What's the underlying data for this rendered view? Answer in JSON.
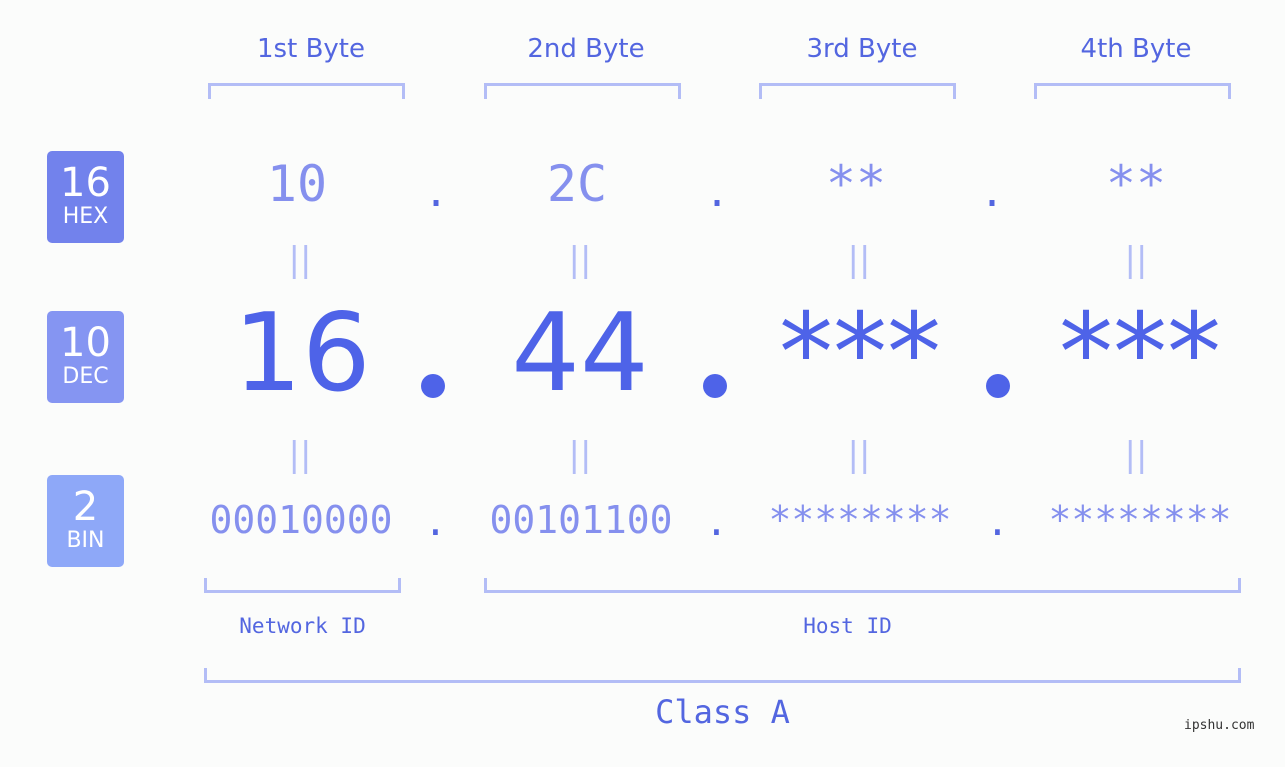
{
  "bytes": [
    {
      "title": "1st Byte",
      "hex": "10",
      "dec": "16",
      "bin": "00010000"
    },
    {
      "title": "2nd Byte",
      "hex": "2C",
      "dec": "44",
      "bin": "00101100"
    },
    {
      "title": "3rd Byte",
      "hex": "**",
      "dec": "***",
      "bin": "********"
    },
    {
      "title": "4th Byte",
      "hex": "**",
      "dec": "***",
      "bin": "********"
    }
  ],
  "badges": {
    "hex": {
      "num": "16",
      "label": "HEX",
      "color": "#7282ec"
    },
    "dec": {
      "num": "10",
      "label": "DEC",
      "color": "#8595f2"
    },
    "bin": {
      "num": "2",
      "label": "BIN",
      "color": "#8ea8f8"
    }
  },
  "separator": ".",
  "equals": "||",
  "labels": {
    "network_id": "Network ID",
    "host_id": "Host ID",
    "class": "Class A"
  },
  "watermark": "ipshu.com",
  "colors": {
    "accent": "#4e63e8",
    "light": "#8590ee",
    "bracket": "#b3bdf6"
  }
}
